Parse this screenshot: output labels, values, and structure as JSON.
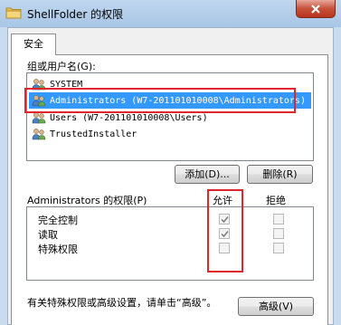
{
  "window": {
    "title": "ShellFolder 的权限",
    "close_label": "✕"
  },
  "tabs": [
    {
      "label": "安全"
    }
  ],
  "groups": {
    "label": "组或用户名(G):",
    "items": [
      {
        "label": "SYSTEM",
        "selected": false
      },
      {
        "label": "Administrators (W7-201101010008\\Administrators)",
        "selected": true
      },
      {
        "label": "Users (W7-201101010008\\Users)",
        "selected": false
      },
      {
        "label": "TrustedInstaller",
        "selected": false
      }
    ]
  },
  "buttons": {
    "add": "添加(D)...",
    "remove": "删除(R)",
    "advanced": "高级(V)"
  },
  "permissions": {
    "header": "Administrators 的权限(P)",
    "allow_header": "允许",
    "deny_header": "拒绝",
    "rows": [
      {
        "label": "完全控制",
        "allow": true,
        "deny": false
      },
      {
        "label": "读取",
        "allow": true,
        "deny": false
      },
      {
        "label": "特殊权限",
        "allow": false,
        "deny": false
      }
    ]
  },
  "footer": {
    "text": "有关特殊权限或高级设置，请单击“高级”。"
  },
  "colors": {
    "selection": "#3399ff",
    "highlight_box": "#e0262c"
  }
}
